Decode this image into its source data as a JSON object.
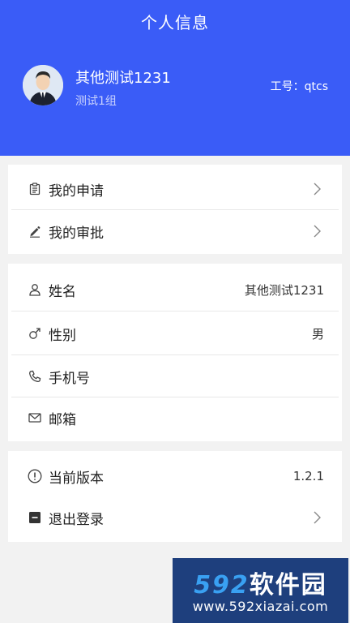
{
  "header": {
    "title": "个人信息",
    "user_name": "其他测试1231",
    "user_group": "测试1组",
    "staff_id": "工号：qtcs",
    "brand_color": "#3a5cf7",
    "avatar_icon": "user-avatar-icon"
  },
  "menu": {
    "applications": {
      "label": "我的申请",
      "icon": "clipboard-icon"
    },
    "approvals": {
      "label": "我的审批",
      "icon": "pen-icon"
    }
  },
  "profile": {
    "name": {
      "label": "姓名",
      "value": "其他测试1231",
      "icon": "person-icon"
    },
    "gender": {
      "label": "性别",
      "value": "男",
      "icon": "male-icon"
    },
    "phone": {
      "label": "手机号",
      "value": "",
      "icon": "phone-icon"
    },
    "email": {
      "label": "邮箱",
      "value": "",
      "icon": "mail-icon"
    }
  },
  "system": {
    "version": {
      "label": "当前版本",
      "value": "1.2.1",
      "icon": "info-icon"
    },
    "logout": {
      "label": "退出登录",
      "icon": "logout-icon"
    }
  },
  "watermark": {
    "logo_number": "592",
    "logo_text": "软件园",
    "url": "www.592xiazai.com"
  }
}
